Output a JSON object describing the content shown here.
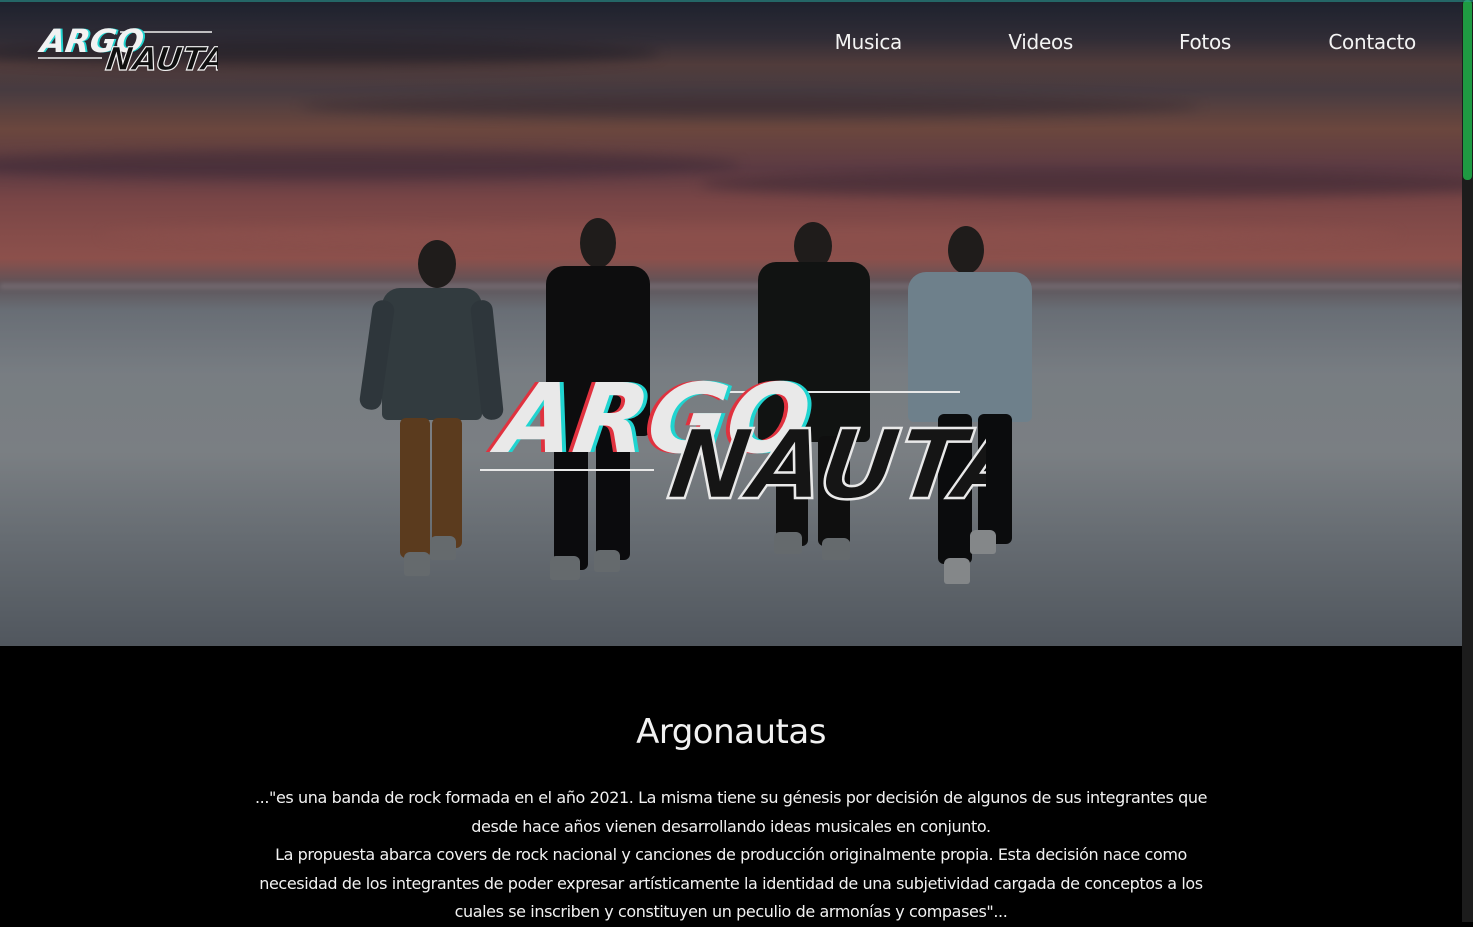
{
  "site": {
    "logo": {
      "part1": "ARGO",
      "part2": "NAUTAS"
    },
    "nav": [
      {
        "label": "Musica"
      },
      {
        "label": "Videos"
      },
      {
        "label": "Fotos"
      },
      {
        "label": "Contacto"
      }
    ]
  },
  "about": {
    "title": "Argonautas",
    "paragraph1": "...\"es una banda de rock formada en el año 2021. La misma tiene su génesis por decisión de algunos de sus integrantes que desde hace años vienen desarrollando ideas musicales en conjunto.",
    "paragraph2": "La propuesta abarca covers de rock nacional y canciones de producción originalmente propia. Esta decisión nace como necesidad de los integrantes de poder expresar artísticamente la identidad de una subjetividad cargada de conceptos a los cuales se inscriben y constituyen un peculio de armonías y compases\"..."
  },
  "colors": {
    "scroll_thumb": "#1f9a42",
    "logo_red": "#e0323f",
    "logo_cyan": "#20d4d0"
  }
}
